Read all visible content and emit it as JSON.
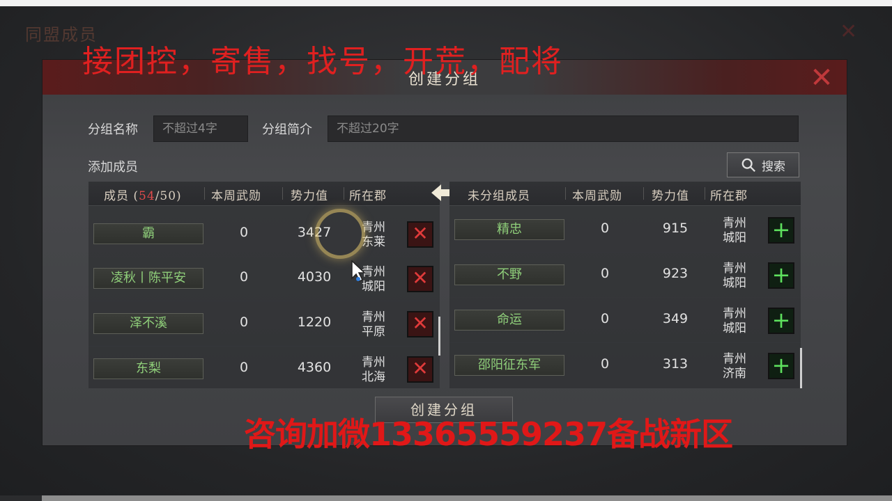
{
  "background": {
    "title": "同盟成员"
  },
  "dialog": {
    "title": "创建分组",
    "group_name_label": "分组名称",
    "group_name_placeholder": "不超过4字",
    "group_intro_label": "分组简介",
    "group_intro_placeholder": "不超过20字",
    "add_members_label": "添加成员",
    "search_label": "搜索",
    "create_button": "创建分组"
  },
  "left_table": {
    "headers": {
      "member_prefix": "成员 (",
      "count": "54",
      "count_suffix": "/50)",
      "weekly_merit": "本周武勋",
      "power": "势力值",
      "county": "所在郡"
    },
    "rows": [
      {
        "name": "霸",
        "merit": "0",
        "power": "3427",
        "region": "青州",
        "city": "东莱"
      },
      {
        "name": "凌秋丨陈平安",
        "merit": "0",
        "power": "4030",
        "region": "青州",
        "city": "城阳"
      },
      {
        "name": "泽不溪",
        "merit": "0",
        "power": "1220",
        "region": "青州",
        "city": "平原"
      },
      {
        "name": "东梨",
        "merit": "0",
        "power": "4360",
        "region": "青州",
        "city": "北海"
      }
    ]
  },
  "right_table": {
    "headers": {
      "member": "未分组成员",
      "weekly_merit": "本周武勋",
      "power": "势力值",
      "county": "所在郡"
    },
    "rows": [
      {
        "name": "精忠",
        "merit": "0",
        "power": "915",
        "region": "青州",
        "city": "城阳"
      },
      {
        "name": "不野",
        "merit": "0",
        "power": "923",
        "region": "青州",
        "city": "城阳"
      },
      {
        "name": "命运",
        "merit": "0",
        "power": "349",
        "region": "青州",
        "city": "城阳"
      },
      {
        "name": "邵阳征东军",
        "merit": "0",
        "power": "313",
        "region": "青州",
        "city": "济南"
      }
    ]
  },
  "overlay": {
    "top_text": "接团控，寄售，找号，开荒，配将",
    "bottom_text": "咨询加微13365559237备战新区"
  },
  "colors": {
    "accent_red": "#e02020",
    "name_green": "#8fcf7a",
    "add_green": "#5ee05e"
  }
}
